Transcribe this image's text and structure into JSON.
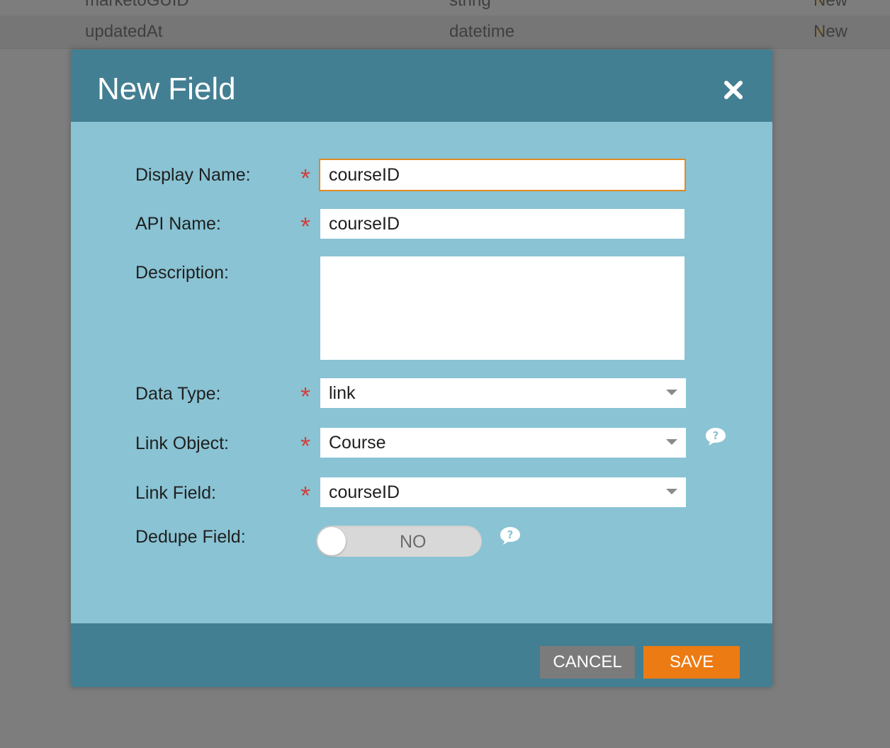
{
  "background_table": {
    "rows": [
      {
        "name": "marketoGUID",
        "type": "string",
        "status": "New"
      },
      {
        "name": "updatedAt",
        "type": "datetime",
        "status": "New"
      }
    ]
  },
  "dialog": {
    "title": "New Field",
    "fields": {
      "display_name": {
        "label": "Display Name:",
        "value": "courseID",
        "required": true
      },
      "api_name": {
        "label": "API Name:",
        "value": "courseID",
        "required": true
      },
      "description": {
        "label": "Description:",
        "value": ""
      },
      "data_type": {
        "label": "Data Type:",
        "value": "link",
        "required": true
      },
      "link_object": {
        "label": "Link Object:",
        "value": "Course",
        "required": true
      },
      "link_field": {
        "label": "Link Field:",
        "value": "courseID",
        "required": true
      },
      "dedupe_field": {
        "label": "Dedupe Field:",
        "value": "NO"
      }
    },
    "required_marker": "*",
    "buttons": {
      "cancel": "CANCEL",
      "save": "SAVE"
    }
  },
  "colors": {
    "header": "#437f92",
    "body": "#89c3d4",
    "save": "#ec7b13",
    "cancel": "#7b7b7b",
    "required": "#d1413a",
    "focus_border": "#e08a23"
  },
  "icons": {
    "close": "close-icon",
    "help": "help-bubble-icon",
    "star": "star-icon",
    "dropdown": "chevron-down-icon"
  }
}
